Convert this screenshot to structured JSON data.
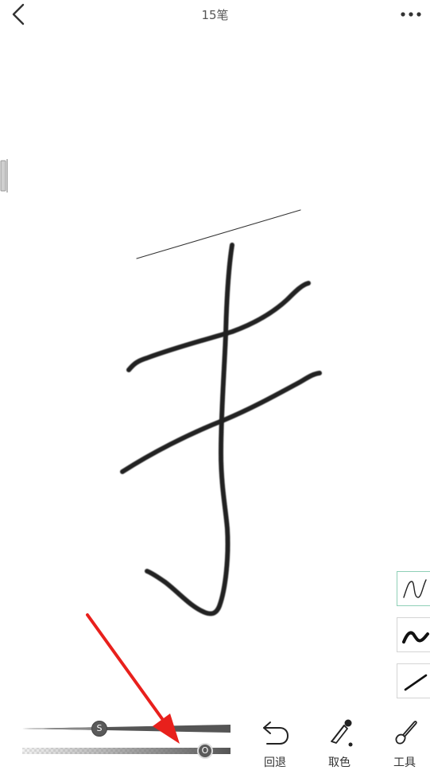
{
  "header": {
    "title": "15笔"
  },
  "brush_types": [
    {
      "name": "thin-pen",
      "selected": true
    },
    {
      "name": "brush-pen",
      "selected": false
    },
    {
      "name": "line-pen",
      "selected": false
    }
  ],
  "sliders": {
    "size": {
      "knob_label": "S",
      "value": 0.37
    },
    "opacity": {
      "knob_label": "O",
      "value": 0.88
    }
  },
  "toolbar": {
    "undo_label": "回退",
    "picker_label": "取色",
    "tools_label": "工具"
  },
  "colors": {
    "accent_selected": "#8fd0b7",
    "annotation_arrow": "#e8201c",
    "ink": "#222222"
  }
}
